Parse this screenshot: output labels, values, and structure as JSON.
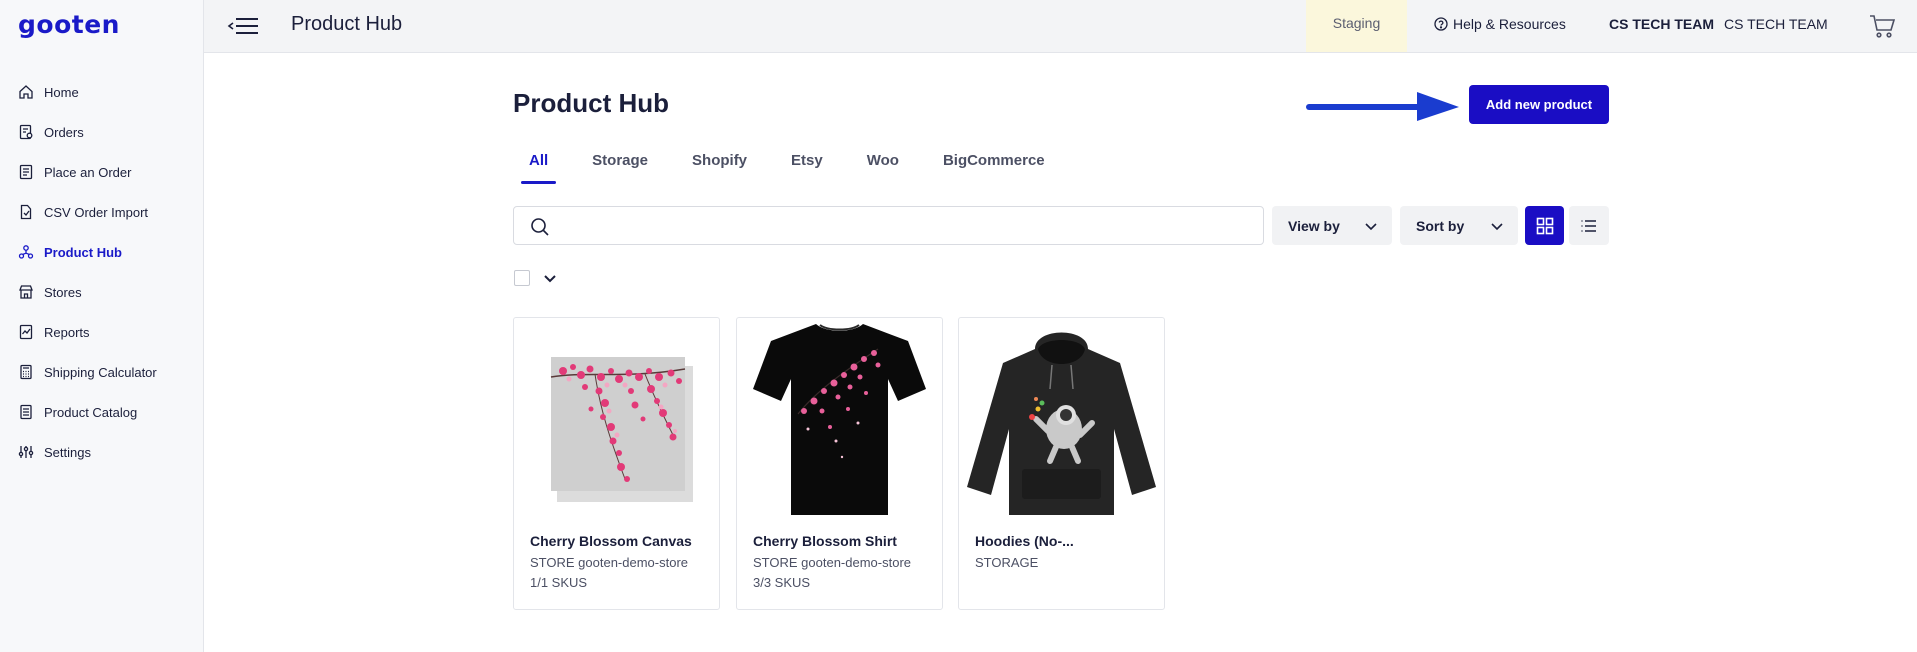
{
  "app": {
    "logo": "gooten",
    "title": "Product Hub"
  },
  "topbar": {
    "staging": "Staging",
    "help": "Help & Resources",
    "team_bold": "CS TECH TEAM",
    "team": "CS TECH TEAM",
    "icons": [
      "menu-collapse-icon",
      "help-circle-icon",
      "cart-icon"
    ]
  },
  "sidebar": {
    "items": [
      {
        "label": "Home",
        "icon": "home-icon"
      },
      {
        "label": "Orders",
        "icon": "orders-icon"
      },
      {
        "label": "Place an Order",
        "icon": "place-order-icon"
      },
      {
        "label": "CSV Order Import",
        "icon": "csv-import-icon"
      },
      {
        "label": "Product Hub",
        "icon": "product-hub-icon",
        "active": true
      },
      {
        "label": "Stores",
        "icon": "store-icon"
      },
      {
        "label": "Reports",
        "icon": "reports-icon"
      },
      {
        "label": "Shipping Calculator",
        "icon": "calculator-icon"
      },
      {
        "label": "Product Catalog",
        "icon": "catalog-icon"
      },
      {
        "label": "Settings",
        "icon": "settings-icon"
      }
    ]
  },
  "main": {
    "title": "Product Hub",
    "add_button": "Add new product",
    "tabs": [
      {
        "label": "All",
        "active": true
      },
      {
        "label": "Storage"
      },
      {
        "label": "Shopify"
      },
      {
        "label": "Etsy"
      },
      {
        "label": "Woo"
      },
      {
        "label": "BigCommerce"
      }
    ],
    "search": {
      "placeholder": "",
      "value": ""
    },
    "view_by": "View by",
    "sort_by": "Sort by",
    "view_mode": "grid",
    "products": [
      {
        "name": "Cherry Blossom Canvas",
        "store": "STORE gooten-demo-store",
        "skus": "1/1 SKUS",
        "image": "canvas"
      },
      {
        "name": "Cherry Blossom Shirt",
        "store": "STORE gooten-demo-store",
        "skus": "3/3 SKUS",
        "image": "tshirt"
      },
      {
        "name": "Hoodies (No-...",
        "store": "STORAGE",
        "skus": "",
        "image": "hoodie"
      }
    ]
  },
  "colors": {
    "accent": "#1a0dc4",
    "link": "#1a1ac8",
    "staging_bg": "#fbf7dc"
  }
}
